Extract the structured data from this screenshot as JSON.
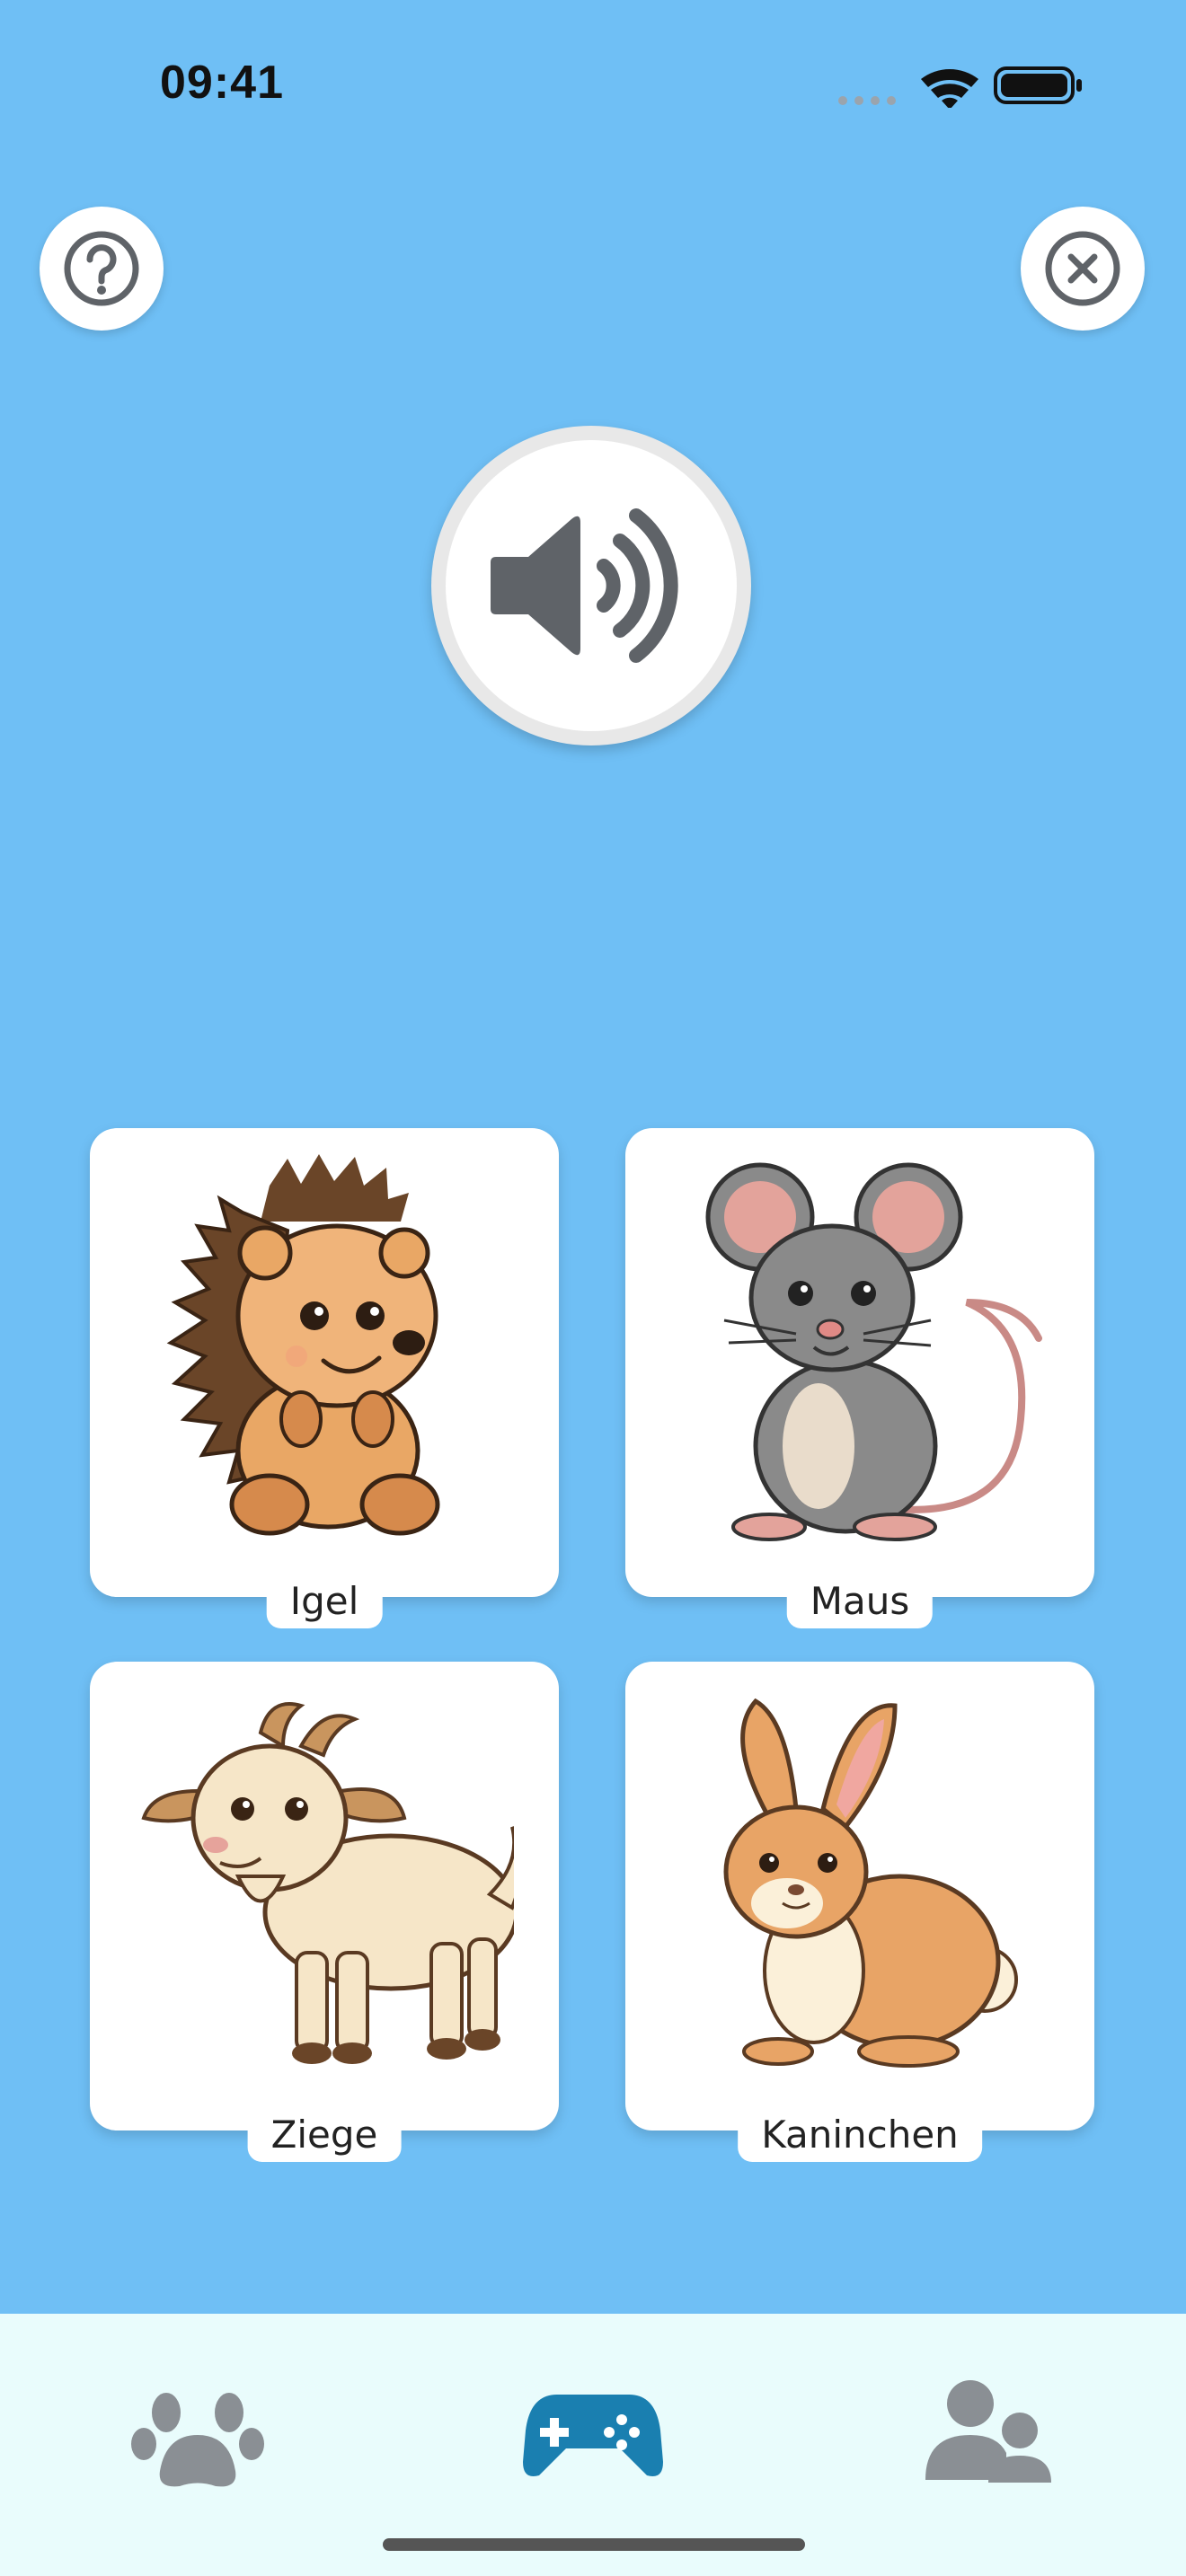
{
  "status_bar": {
    "time": "09:41",
    "icons": [
      "signal-icon",
      "wifi-icon",
      "battery-icon"
    ]
  },
  "header": {
    "help_icon": "question-mark-icon",
    "close_icon": "close-icon"
  },
  "sound_button": {
    "icon": "speaker-icon"
  },
  "cards": [
    {
      "label": "Igel",
      "image": "hedgehog"
    },
    {
      "label": "Maus",
      "image": "mouse"
    },
    {
      "label": "Ziege",
      "image": "goat"
    },
    {
      "label": "Kaninchen",
      "image": "rabbit"
    }
  ],
  "tab_bar": {
    "tabs": [
      {
        "icon": "paw-icon",
        "active": false
      },
      {
        "icon": "gamepad-icon",
        "active": true
      },
      {
        "icon": "users-icon",
        "active": false
      }
    ],
    "active_color": "#1a7fb0",
    "inactive_color": "#8a8f94"
  },
  "colors": {
    "background": "#6fbff5",
    "card": "#ffffff"
  }
}
